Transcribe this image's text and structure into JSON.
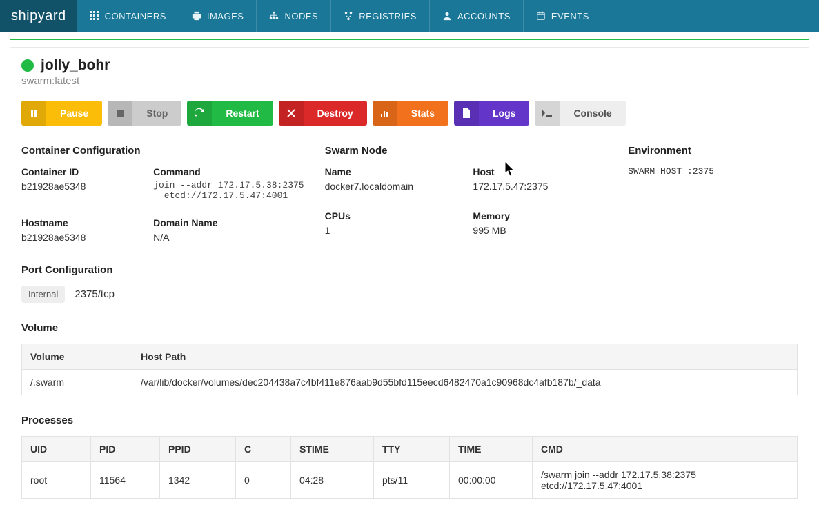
{
  "brand": "shipyard",
  "nav": [
    {
      "label": "CONTAINERS",
      "icon": "grid"
    },
    {
      "label": "IMAGES",
      "icon": "print"
    },
    {
      "label": "NODES",
      "icon": "sitemap"
    },
    {
      "label": "REGISTRIES",
      "icon": "fork"
    },
    {
      "label": "ACCOUNTS",
      "icon": "user"
    },
    {
      "label": "EVENTS",
      "icon": "calendar"
    }
  ],
  "container": {
    "name": "jolly_bohr",
    "image": "swarm:latest",
    "status": "running"
  },
  "actions": {
    "pause": "Pause",
    "stop": "Stop",
    "restart": "Restart",
    "destroy": "Destroy",
    "stats": "Stats",
    "logs": "Logs",
    "console": "Console"
  },
  "sections": {
    "config_title": "Container Configuration",
    "swarm_title": "Swarm Node",
    "env_title": "Environment",
    "port_title": "Port Configuration",
    "volume_title": "Volume",
    "processes_title": "Processes"
  },
  "config": {
    "container_id_label": "Container ID",
    "container_id": "b21928ae5348",
    "command_label": "Command",
    "command": "join --addr 172.17.5.38:2375\n  etcd://172.17.5.47:4001",
    "hostname_label": "Hostname",
    "hostname": "b21928ae5348",
    "domain_label": "Domain Name",
    "domain": "N/A"
  },
  "swarm": {
    "name_label": "Name",
    "name": "docker7.localdomain",
    "host_label": "Host",
    "host": "172.17.5.47:2375",
    "cpus_label": "CPUs",
    "cpus": "1",
    "memory_label": "Memory",
    "memory": "995 MB"
  },
  "env": [
    "SWARM_HOST=:2375"
  ],
  "port": {
    "badge": "Internal",
    "value": "2375/tcp"
  },
  "volume": {
    "headers": [
      "Volume",
      "Host Path"
    ],
    "rows": [
      [
        "/.swarm",
        "/var/lib/docker/volumes/dec204438a7c4bf411e876aab9d55bfd115eecd6482470a1c90968dc4afb187b/_data"
      ]
    ]
  },
  "processes": {
    "headers": [
      "UID",
      "PID",
      "PPID",
      "C",
      "STIME",
      "TTY",
      "TIME",
      "CMD"
    ],
    "rows": [
      [
        "root",
        "11564",
        "1342",
        "0",
        "04:28",
        "pts/11",
        "00:00:00",
        "/swarm join --addr 172.17.5.38:2375 etcd://172.17.5.47:4001"
      ]
    ]
  }
}
